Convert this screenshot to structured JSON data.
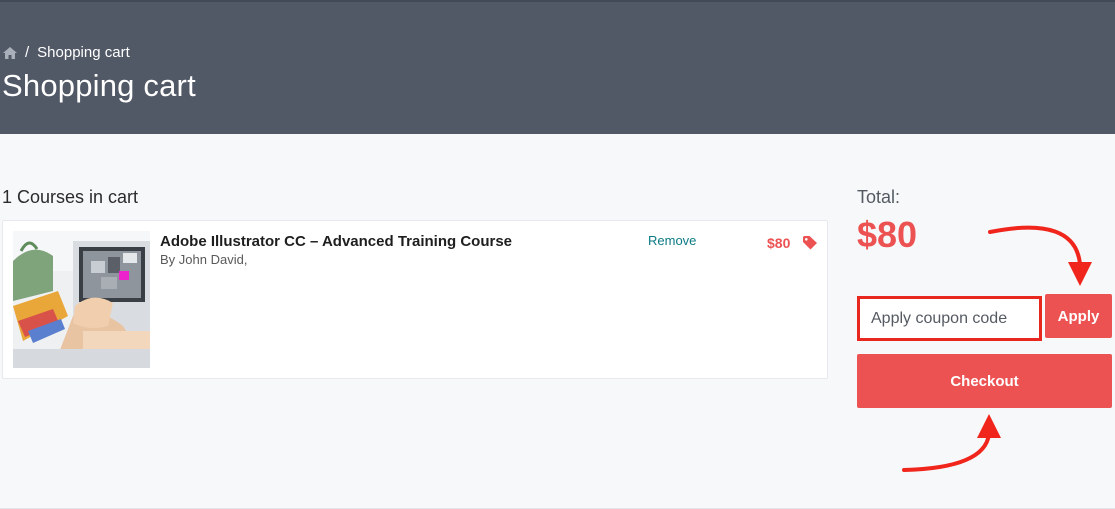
{
  "header": {
    "breadcrumb_icon": "home-icon",
    "breadcrumb_separator": "/",
    "breadcrumb_current": "Shopping cart",
    "title": "Shopping cart",
    "background_color": "#515866"
  },
  "cart": {
    "count_label": "1 Courses in cart",
    "items": [
      {
        "title": "Adobe Illustrator CC – Advanced Training Course",
        "author": "By John David,",
        "remove_label": "Remove",
        "price": "$80",
        "price_icon": "tag-icon",
        "thumbnail": "laptop-design-image"
      }
    ]
  },
  "summary": {
    "total_label": "Total:",
    "total_value": "$80",
    "coupon_placeholder": "Apply coupon code",
    "apply_label": "Apply",
    "checkout_label": "Checkout"
  },
  "annotations": {
    "highlight_color": "#e8281f",
    "arrows": [
      "arrow-to-apply",
      "arrow-to-checkout"
    ]
  },
  "colors": {
    "accent": "#ec5252",
    "link": "#0c7a85"
  }
}
